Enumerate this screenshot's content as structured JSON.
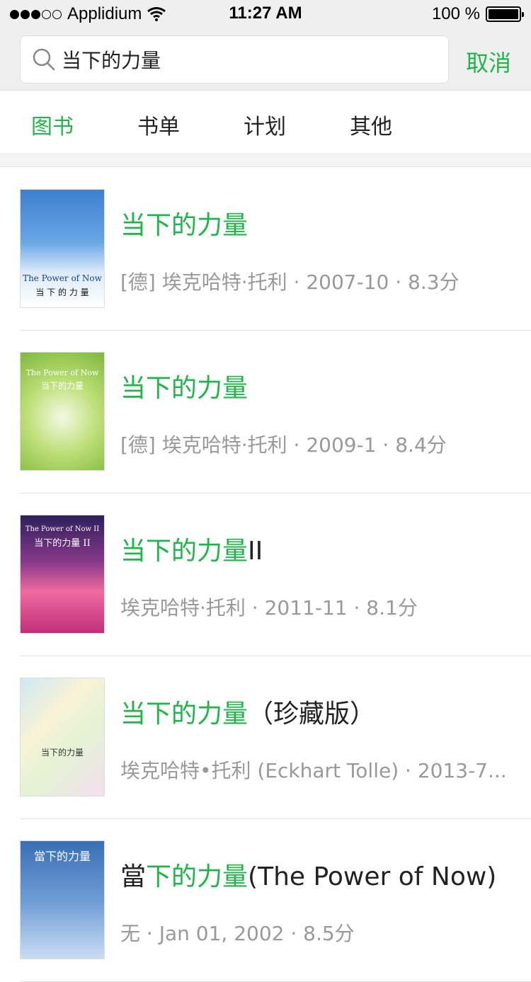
{
  "status": {
    "carrier": "Applidium",
    "time": "11:27 AM",
    "battery": "100 %"
  },
  "search": {
    "query": "当下的力量",
    "cancel_label": "取消"
  },
  "tabs": [
    "图书",
    "书单",
    "计划",
    "其他"
  ],
  "active_tab": "图书",
  "results": [
    {
      "title_highlight": "当下的力量",
      "title_rest": "",
      "meta": "[德] 埃克哈特·托利 · 2007-10 · 8.3分",
      "cover": {
        "title": "The Power of Now",
        "subtitle": "当 下 的 力 量",
        "colors": [
          "#4a8fd8",
          "#ffffff"
        ]
      }
    },
    {
      "title_highlight": "当下的力量",
      "title_rest": "",
      "meta": "[德] 埃克哈特·托利 · 2009-1 · 8.4分",
      "cover": {
        "title": "The Power of Now",
        "subtitle": "当下的力量",
        "colors": [
          "#9ccc55",
          "#e8f3c8"
        ]
      }
    },
    {
      "title_highlight": "当下的力量",
      "title_rest": "II",
      "meta": "埃克哈特·托利 · 2011-11 · 8.1分",
      "cover": {
        "title": "The Power of Now II",
        "subtitle": "当下的力量 II",
        "colors": [
          "#3a2a6a",
          "#e84a8a"
        ]
      }
    },
    {
      "title_highlight": "当下的力量",
      "title_rest": "（珍藏版）",
      "meta": "埃克哈特•托利 (Eckhart Tolle) · 2013-7...",
      "cover": {
        "title": "",
        "subtitle": "当下的力量",
        "colors": [
          "#cfe8f0",
          "#f7f0d8"
        ]
      }
    },
    {
      "title_prefix": "當",
      "title_highlight": "下的力量",
      "title_rest": "(The Power of Now)",
      "meta": "无 · Jan 01, 2002 · 8.5分",
      "cover": {
        "title": "",
        "subtitle": "當下的力量",
        "colors": [
          "#3a6fb6",
          "#c9ddf2"
        ]
      }
    }
  ],
  "colors": {
    "accent": "#21b44b",
    "meta": "#999999",
    "bar_bg": "#efefef"
  }
}
